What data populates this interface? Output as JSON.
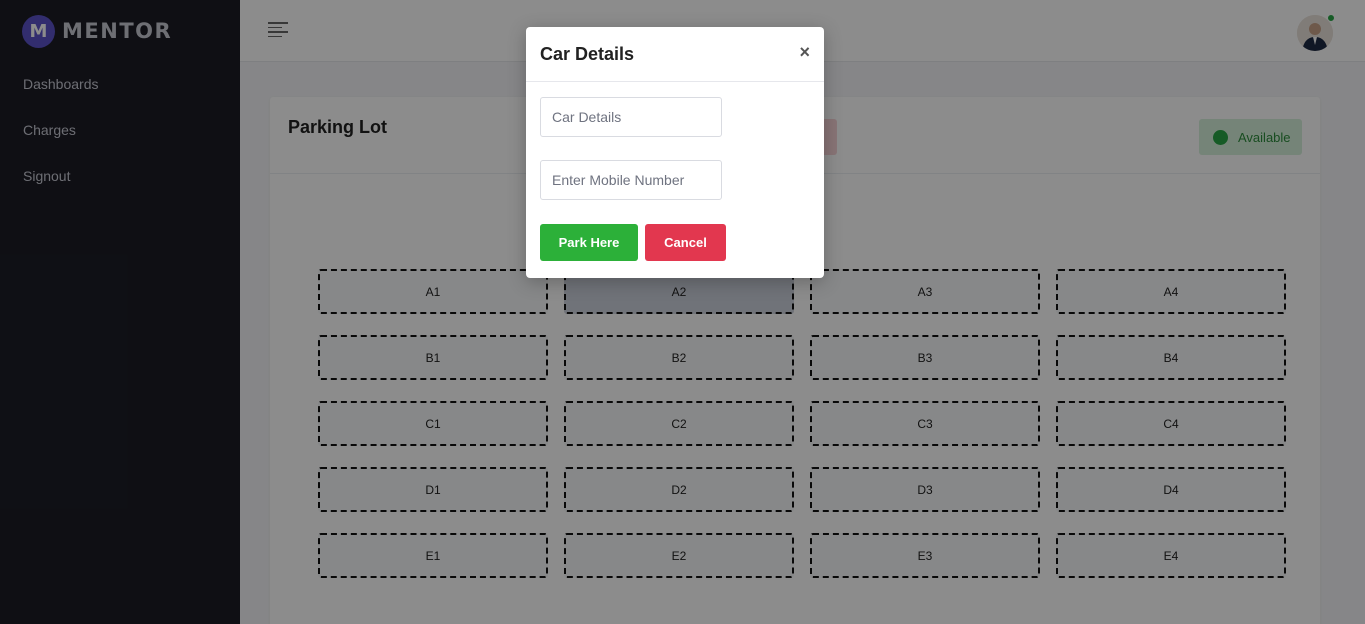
{
  "brand": {
    "logo_letter": "M",
    "name": "MENTOR",
    "accent": "#5b52c9"
  },
  "sidebar": {
    "items": [
      {
        "label": "Dashboards"
      },
      {
        "label": "Charges"
      },
      {
        "label": "Signout"
      }
    ]
  },
  "topbar": {
    "menu_icon": "hamburger-menu-icon",
    "avatar_status": "online"
  },
  "card": {
    "title": "Parking Lot",
    "legend": {
      "available_label": "Available",
      "available_color": "#28a745",
      "occupied_color": "#f8d4d8"
    }
  },
  "slots": [
    [
      "A1",
      "A2",
      "A3",
      "A4"
    ],
    [
      "B1",
      "B2",
      "B3",
      "B4"
    ],
    [
      "C1",
      "C2",
      "C3",
      "C4"
    ],
    [
      "D1",
      "D2",
      "D3",
      "D4"
    ],
    [
      "E1",
      "E2",
      "E3",
      "E4"
    ]
  ],
  "selected_slot": "A2",
  "modal": {
    "title": "Car Details",
    "close_symbol": "×",
    "car_details_placeholder": "Car Details",
    "mobile_placeholder": "Enter Mobile Number",
    "park_button": "Park Here",
    "cancel_button": "Cancel"
  }
}
